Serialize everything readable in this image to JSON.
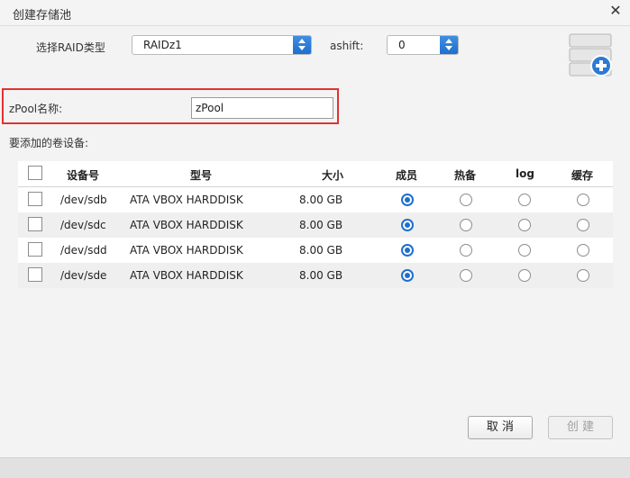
{
  "dialog": {
    "title": "创建存储池",
    "close_symbol": "✕"
  },
  "form": {
    "raid_label": "选择RAID类型",
    "raid_value": "RAIDz1",
    "ashift_label": "ashift:",
    "ashift_value": "0",
    "zpool_label": "zPool名称:",
    "zpool_value": "zPool",
    "devices_label": "要添加的卷设备:"
  },
  "table": {
    "headers": [
      "设备号",
      "型号",
      "大小",
      "成员",
      "热备",
      "log",
      "缓存"
    ],
    "rows": [
      {
        "device": "/dev/sdb",
        "model": "ATA VBOX HARDDISK",
        "size": "8.00 GB",
        "role": "member"
      },
      {
        "device": "/dev/sdc",
        "model": "ATA VBOX HARDDISK",
        "size": "8.00 GB",
        "role": "member"
      },
      {
        "device": "/dev/sdd",
        "model": "ATA VBOX HARDDISK",
        "size": "8.00 GB",
        "role": "member"
      },
      {
        "device": "/dev/sde",
        "model": "ATA VBOX HARDDISK",
        "size": "8.00 GB",
        "role": "member"
      }
    ]
  },
  "buttons": {
    "cancel": "取 消",
    "create": "创 建"
  },
  "icons": {
    "header": "database-add-icon",
    "close": "close-icon"
  },
  "colors": {
    "accent": "#1e6fcf",
    "highlight_border": "#e03232"
  }
}
